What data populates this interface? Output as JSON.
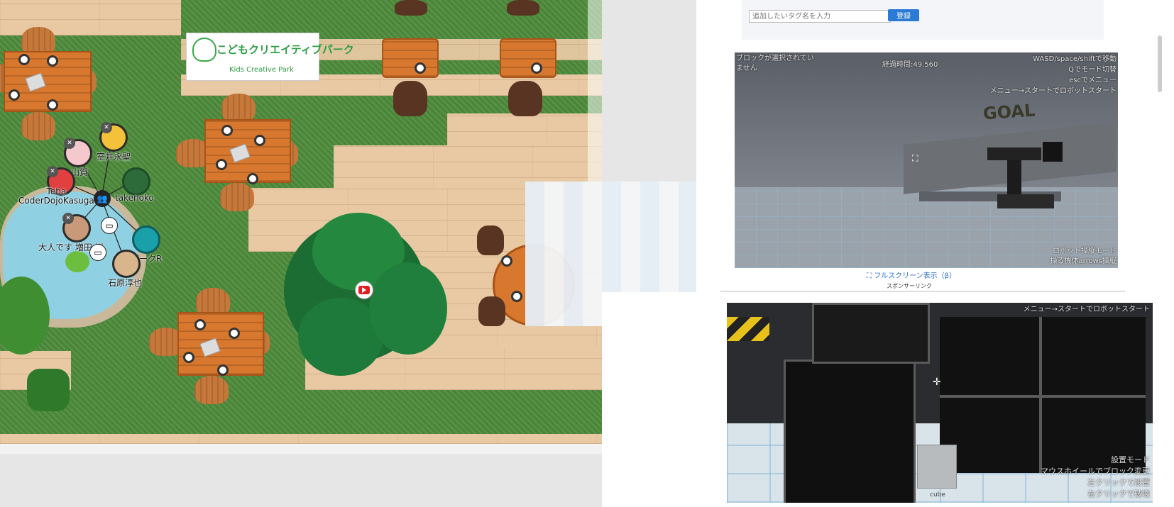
{
  "map": {
    "logo": {
      "title": "こどもクリエイティブパーク",
      "subtitle": "Kids Creative Park"
    },
    "avatars": [
      {
        "name": "室井永聖"
      },
      {
        "name": "山賀"
      },
      {
        "name": "Teba\nCoderDojoKasuga"
      },
      {
        "name": "takenoko"
      },
      {
        "name": "大人です 増田 樹"
      },
      {
        "name": "鉄道パークR"
      },
      {
        "name": "石原淳也"
      }
    ],
    "icons": {
      "mic_muted": "mic-off-icon",
      "screen": "monitor-icon",
      "group": "group-icon",
      "youtube": "youtube-play-icon"
    }
  },
  "tags": {
    "input_placeholder": "追加したいタグ名を入力",
    "add_button": "登録"
  },
  "game1": {
    "top_left": "ブロックが選択されていません",
    "timer": "経過時間:49.560",
    "top_right": [
      "WASD/space/shiftで移動",
      "Qでモード切替",
      "escでメニュー",
      "メニュー→スタートでロボットスタート"
    ],
    "goal": "GOAL",
    "bottom_right": [
      "ロボット操縦モード",
      "操る機体arrows操縦"
    ]
  },
  "fullscreen": {
    "label": "フルスクリーン表示（β）",
    "icon": "expand-icon"
  },
  "sponsor": {
    "label": "スポンサーリンク"
  },
  "game2": {
    "top_right": "メニュー→スタートでロボットスタート",
    "bottom_right": [
      "設置モード",
      "マウスホイールでブロック変更",
      "左クリックで設置",
      "右クリックで破壊"
    ],
    "cube_label": "cube"
  }
}
